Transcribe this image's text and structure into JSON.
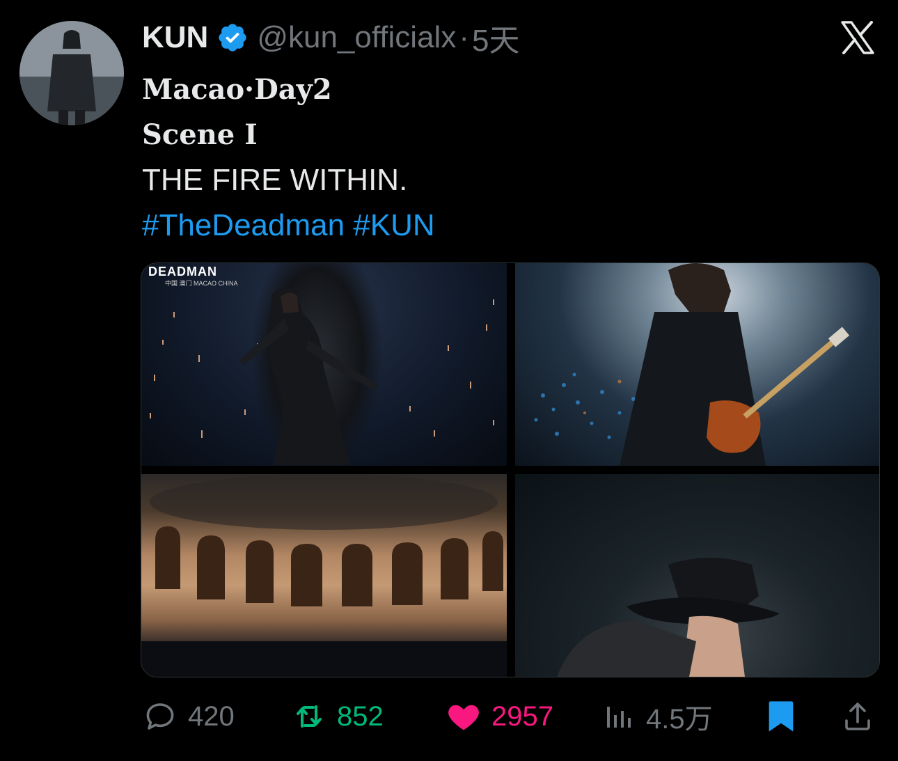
{
  "tweet": {
    "author": {
      "display_name": "KUN",
      "handle": "@kun_officialx",
      "verified": true
    },
    "separator": "·",
    "time": "5天",
    "lines": [
      "Macao·Day2",
      "Scene Ⅰ",
      "THE FIRE WITHIN."
    ],
    "hashtags": [
      "#TheDeadman",
      "#KUN"
    ],
    "media": {
      "tile1_overlay_title": "DEADMAN",
      "tile1_overlay_subtitle": "中国 澳门",
      "tile1_overlay_caption": "MACAO CHINA"
    },
    "actions": {
      "replies": "420",
      "reposts": "852",
      "likes": "2957",
      "views": "4.5万"
    }
  },
  "icons": {
    "verified": "verified-badge-icon",
    "platform": "x-logo-icon",
    "reply": "reply-icon",
    "repost": "repost-icon",
    "like": "heart-icon",
    "views": "views-icon",
    "bookmark": "bookmark-icon",
    "share": "share-icon"
  },
  "colors": {
    "background": "#000000",
    "text": "#e7e9ea",
    "muted": "#71767b",
    "link": "#1d9bf0",
    "repost": "#00ba7c",
    "like": "#f91880",
    "bookmark": "#1d9bf0"
  }
}
